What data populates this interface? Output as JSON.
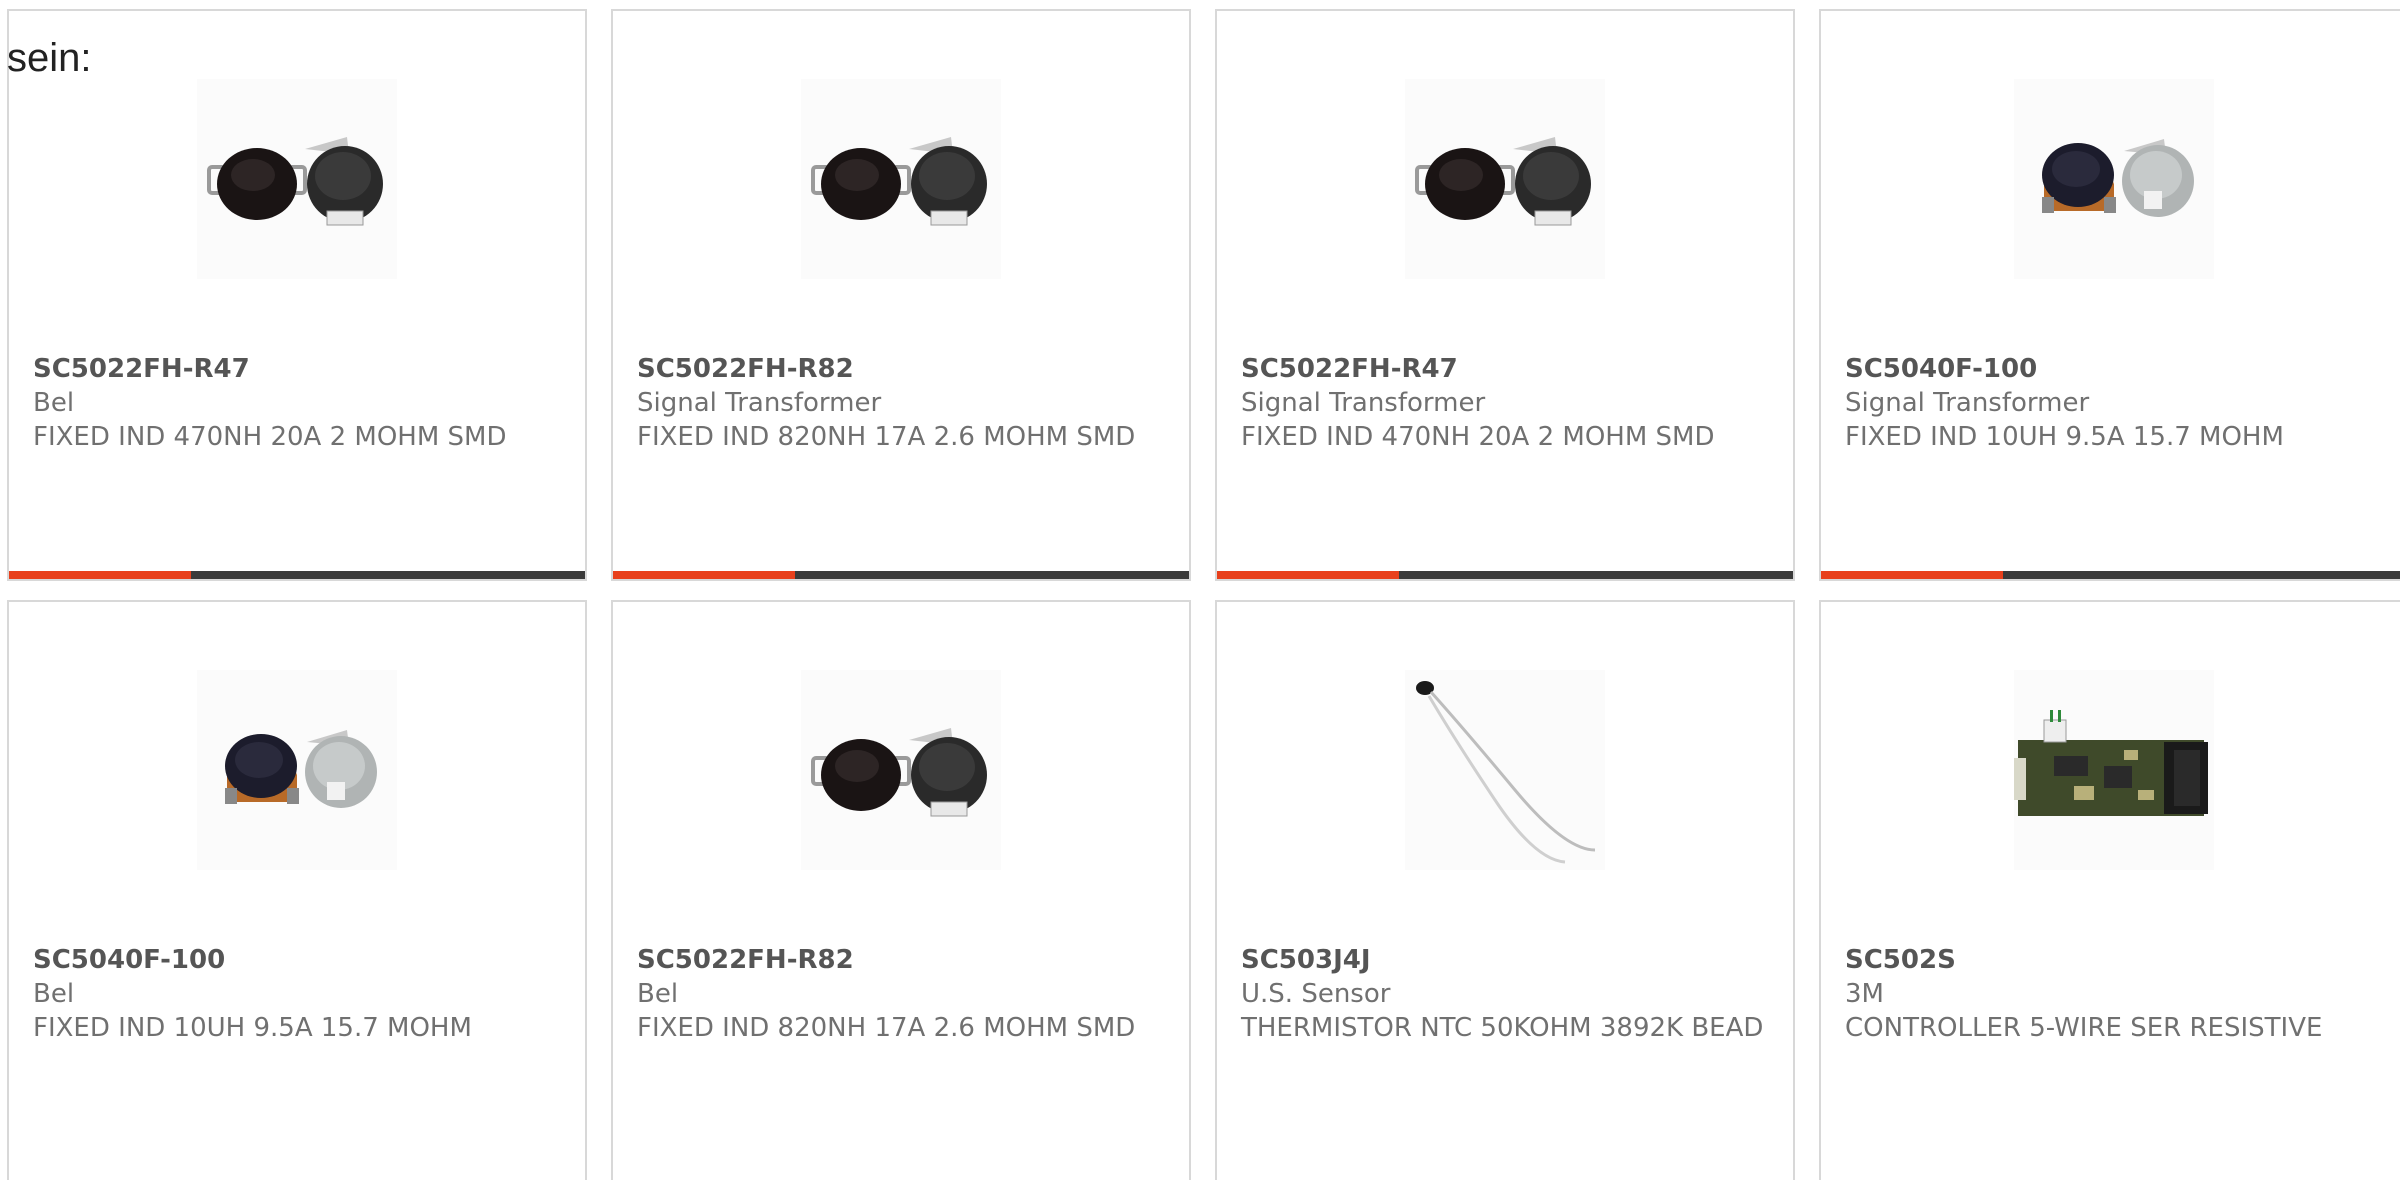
{
  "intro_text": "sein:",
  "colors": {
    "accent": "#e8401c",
    "bar": "#3a3a3a",
    "text": "#666666",
    "border": "#d8d8d8"
  },
  "products": [
    {
      "part_number": "SC5022FH-R47",
      "manufacturer": "Bel",
      "description": "FIXED IND 470NH 20A 2 MOHM SMD",
      "image": "smd-inductor-pair-icon"
    },
    {
      "part_number": "SC5022FH-R82",
      "manufacturer": "Signal Transformer",
      "description": "FIXED IND 820NH 17A 2.6 MOHM SMD",
      "image": "smd-inductor-pair-icon"
    },
    {
      "part_number": "SC5022FH-R47",
      "manufacturer": "Signal Transformer",
      "description": "FIXED IND 470NH 20A 2 MOHM SMD",
      "image": "smd-inductor-pair-icon"
    },
    {
      "part_number": "SC5040F-100",
      "manufacturer": "Signal Transformer",
      "description": "FIXED IND 10UH 9.5A 15.7 MOHM",
      "image": "smd-inductor-copper-pair-icon"
    },
    {
      "part_number": "SC5040F-100",
      "manufacturer": "Bel",
      "description": "FIXED IND 10UH 9.5A 15.7 MOHM",
      "image": "smd-inductor-copper-pair-icon"
    },
    {
      "part_number": "SC5022FH-R82",
      "manufacturer": "Bel",
      "description": "FIXED IND 820NH 17A 2.6 MOHM SMD",
      "image": "smd-inductor-pair-icon"
    },
    {
      "part_number": "SC503J4J",
      "manufacturer": "U.S. Sensor",
      "description": "THERMISTOR NTC 50KOHM 3892K BEAD",
      "image": "thermistor-bead-icon"
    },
    {
      "part_number": "SC502S",
      "manufacturer": "3M",
      "description": "CONTROLLER 5-WIRE SER RESISTIVE",
      "image": "controller-board-icon"
    }
  ]
}
